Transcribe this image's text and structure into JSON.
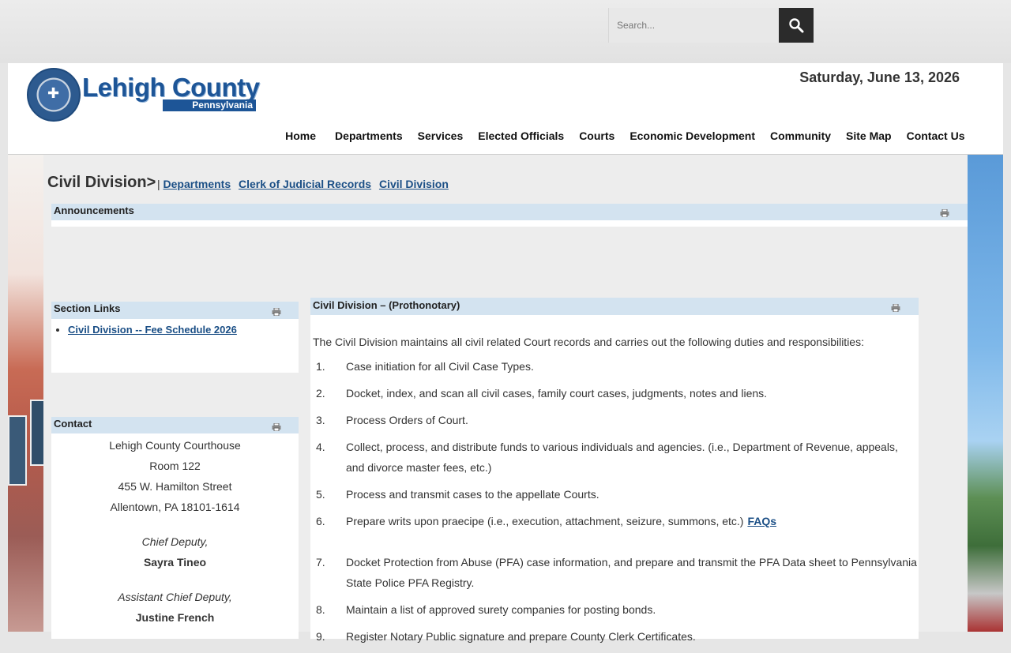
{
  "search": {
    "placeholder": "Search..."
  },
  "header": {
    "logo_name": "Lehigh County",
    "logo_state": "Pennsylvania",
    "date": "Saturday, June 13, 2026"
  },
  "nav": {
    "items": [
      {
        "label": "Home"
      },
      {
        "label": "Departments"
      },
      {
        "label": "Services"
      },
      {
        "label": "Elected Officials"
      },
      {
        "label": "Courts"
      },
      {
        "label": "Economic Development"
      },
      {
        "label": "Community"
      },
      {
        "label": "Site Map"
      },
      {
        "label": "Contact Us"
      }
    ]
  },
  "breadcrumb": {
    "title": "Civil Division>",
    "separator": "|",
    "links": [
      "Departments",
      "Clerk of Judicial Records",
      "Civil Division"
    ]
  },
  "announcements": {
    "heading": "Announcements"
  },
  "section_links": {
    "heading": "Section Links",
    "items": [
      {
        "label": "Civil Division -- Fee Schedule 2026"
      }
    ]
  },
  "contact": {
    "heading": "Contact",
    "building": "Lehigh County Courthouse",
    "room": "Room 122",
    "street": "455 W. Hamilton Street",
    "city": "Allentown, PA 18101-1614",
    "role1": "Chief Deputy,",
    "name1": "Sayra Tineo",
    "role2": "Assistant Chief Deputy,",
    "name2": "Justine French"
  },
  "main": {
    "heading": "Civil Division – (Prothonotary)",
    "intro": "The Civil Division maintains all civil related Court records and carries out the following duties and responsibilities:",
    "duties": [
      {
        "num": "1.",
        "text": "Case initiation for all Civil Case Types."
      },
      {
        "num": "2.",
        "text": "Docket, index, and scan all civil cases, family court cases, judgments, notes and liens."
      },
      {
        "num": "3.",
        "text": "Process Orders of Court."
      },
      {
        "num": "4.",
        "text": "Collect, process, and distribute funds to various individuals and agencies. (i.e., Department of Revenue, appeals, and divorce master fees, etc.)"
      },
      {
        "num": "5.",
        "text": "Process and transmit cases to the appellate Courts."
      },
      {
        "num": "6.",
        "text": "Prepare writs upon praecipe (i.e., execution, attachment, seizure, summons, etc.)",
        "link": "FAQs"
      },
      {
        "num": "7.",
        "text": "Docket Protection from Abuse (PFA) case information, and prepare and transmit the PFA Data sheet to Pennsylvania State Police PFA Registry."
      },
      {
        "num": "8.",
        "text": "Maintain a list of approved surety companies for posting bonds."
      },
      {
        "num": "9.",
        "text": "Register Notary Public signature and prepare County Clerk Certificates."
      }
    ]
  }
}
